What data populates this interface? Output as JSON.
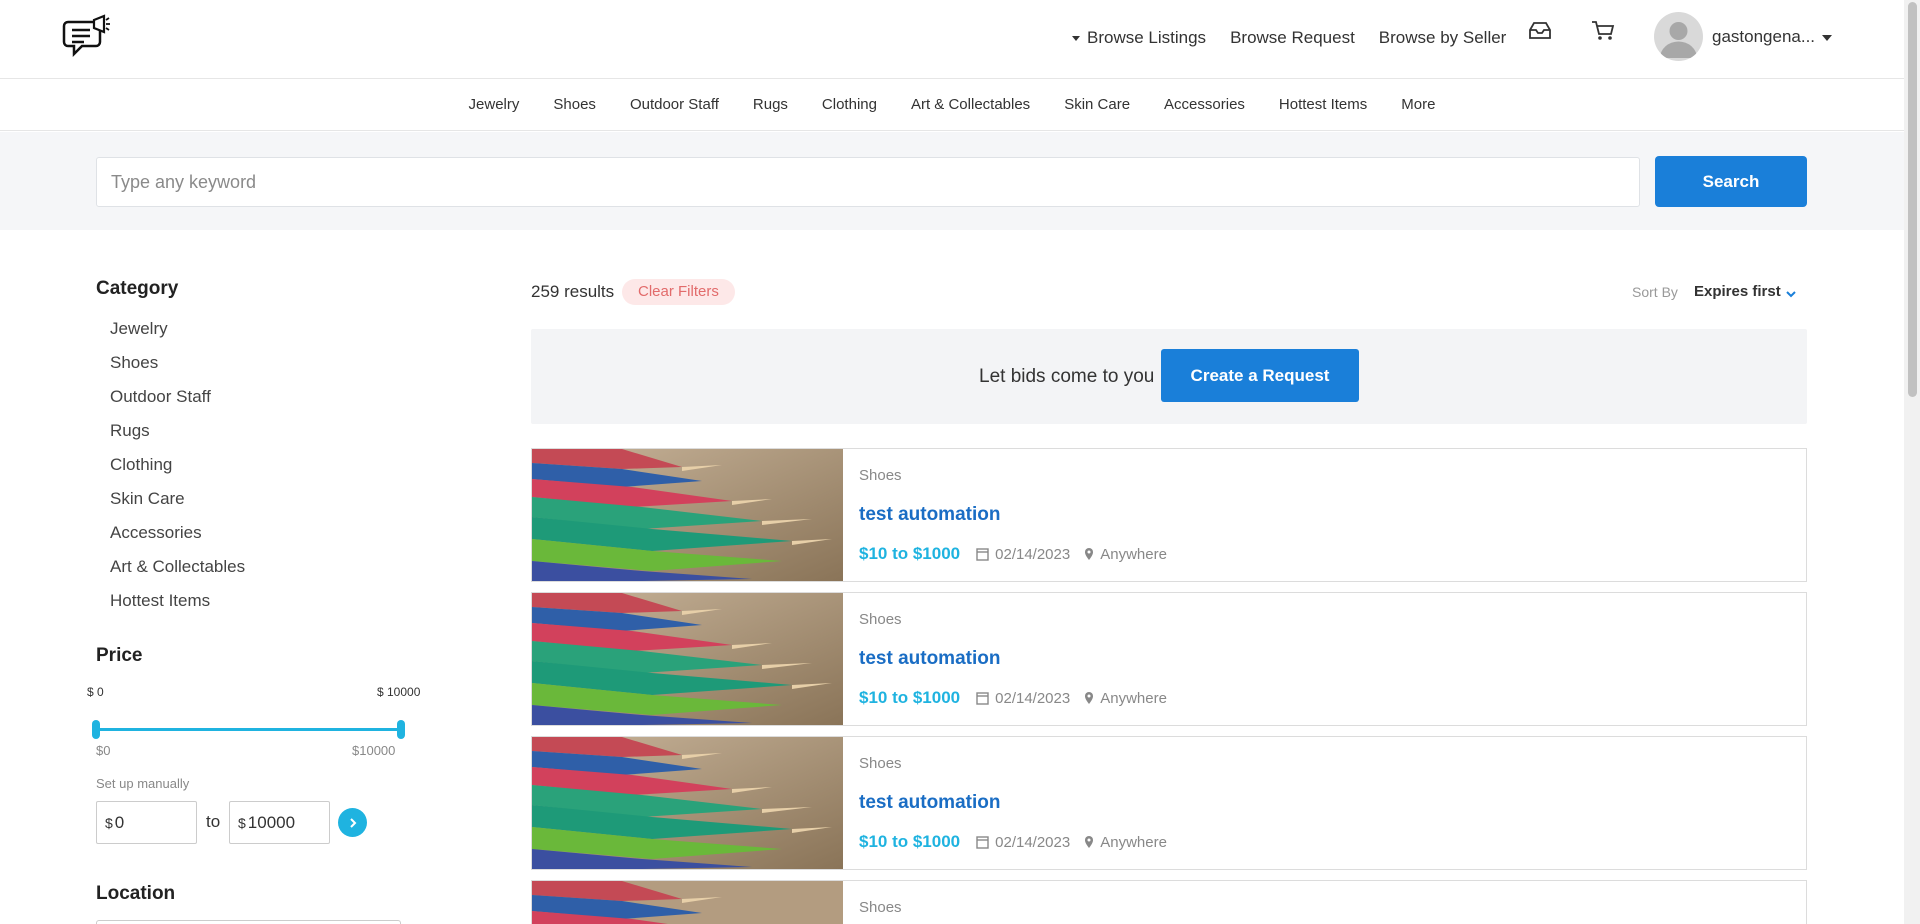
{
  "header": {
    "nav": [
      "Browse Listings",
      "Browse Request",
      "Browse by Seller"
    ],
    "username": "gastongena..."
  },
  "categories_nav": [
    "Jewelry",
    "Shoes",
    "Outdoor Staff",
    "Rugs",
    "Clothing",
    "Art & Collectables",
    "Skin Care",
    "Accessories",
    "Hottest Items",
    "More"
  ],
  "search": {
    "placeholder": "Type any keyword",
    "button": "Search"
  },
  "sidebar": {
    "category_title": "Category",
    "categories": [
      "Jewelry",
      "Shoes",
      "Outdoor Staff",
      "Rugs",
      "Clothing",
      "Skin Care",
      "Accessories",
      "Art & Collectables",
      "Hottest Items"
    ],
    "price_title": "Price",
    "price_min_label": "$ 0",
    "price_max_label": "$ 10000",
    "range_min": "$0",
    "range_max": "$10000",
    "setup_label": "Set up manually",
    "currency": "$",
    "min_value": "0",
    "max_value": "10000",
    "to_label": "to",
    "location_title": "Location"
  },
  "results": {
    "count": "259 results",
    "clear_filters": "Clear Filters",
    "sort_label": "Sort By",
    "sort_value": "Expires first",
    "cta_text": "Let bids come to you",
    "cta_button": "Create a Request",
    "items": [
      {
        "category": "Shoes",
        "title": "test automation",
        "price": "$10 to $1000",
        "date": "02/14/2023",
        "location": "Anywhere"
      },
      {
        "category": "Shoes",
        "title": "test automation",
        "price": "$10 to $1000",
        "date": "02/14/2023",
        "location": "Anywhere"
      },
      {
        "category": "Shoes",
        "title": "test automation",
        "price": "$10 to $1000",
        "date": "02/14/2023",
        "location": "Anywhere"
      },
      {
        "category": "Shoes",
        "title": "",
        "price": "",
        "date": "",
        "location": ""
      }
    ]
  },
  "colors": {
    "accent": "#1a7fd9",
    "cyan": "#1fb3e0",
    "clear_bg": "#fde8e8",
    "clear_text": "#e26b6b"
  }
}
